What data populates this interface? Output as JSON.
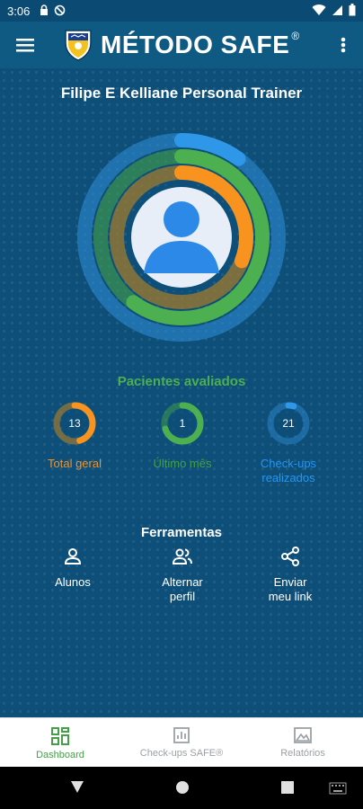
{
  "status_bar": {
    "time": "3:06"
  },
  "app_bar": {
    "title": "MÉTODO SAFE",
    "registered": "®"
  },
  "profile": {
    "name": "Filipe E Kelliane   Personal Trainer"
  },
  "rings": {
    "outer_progress": 0.1,
    "middle_progress": 0.6,
    "inner_progress": 0.3
  },
  "patients": {
    "title": "Pacientes avaliados",
    "stats": [
      {
        "value": "13",
        "label": "Total geral",
        "color": "#f2922a",
        "progress": 0.45
      },
      {
        "value": "1",
        "label": "Último mês",
        "color": "#43a047",
        "progress": 0.7
      },
      {
        "value": "21",
        "label": "Check-ups realizados",
        "color": "#2196f3",
        "progress": 0.05
      }
    ]
  },
  "tools": {
    "title": "Ferramentas",
    "items": [
      {
        "label": "Alunos",
        "icon": "person-icon"
      },
      {
        "label": "Alternar perfil",
        "icon": "people-icon"
      },
      {
        "label": "Enviar meu link",
        "icon": "share-icon"
      }
    ]
  },
  "bottom_nav": {
    "items": [
      {
        "label": "Dashboard",
        "icon": "dashboard-icon",
        "active": true
      },
      {
        "label": "Check-ups SAFE®",
        "icon": "checkup-icon",
        "active": false
      },
      {
        "label": "Relatórios",
        "icon": "reports-icon",
        "active": false
      }
    ]
  },
  "colors": {
    "background": "#0d4f78",
    "green": "#43a047",
    "orange": "#f2922a",
    "blue": "#2196f3"
  }
}
